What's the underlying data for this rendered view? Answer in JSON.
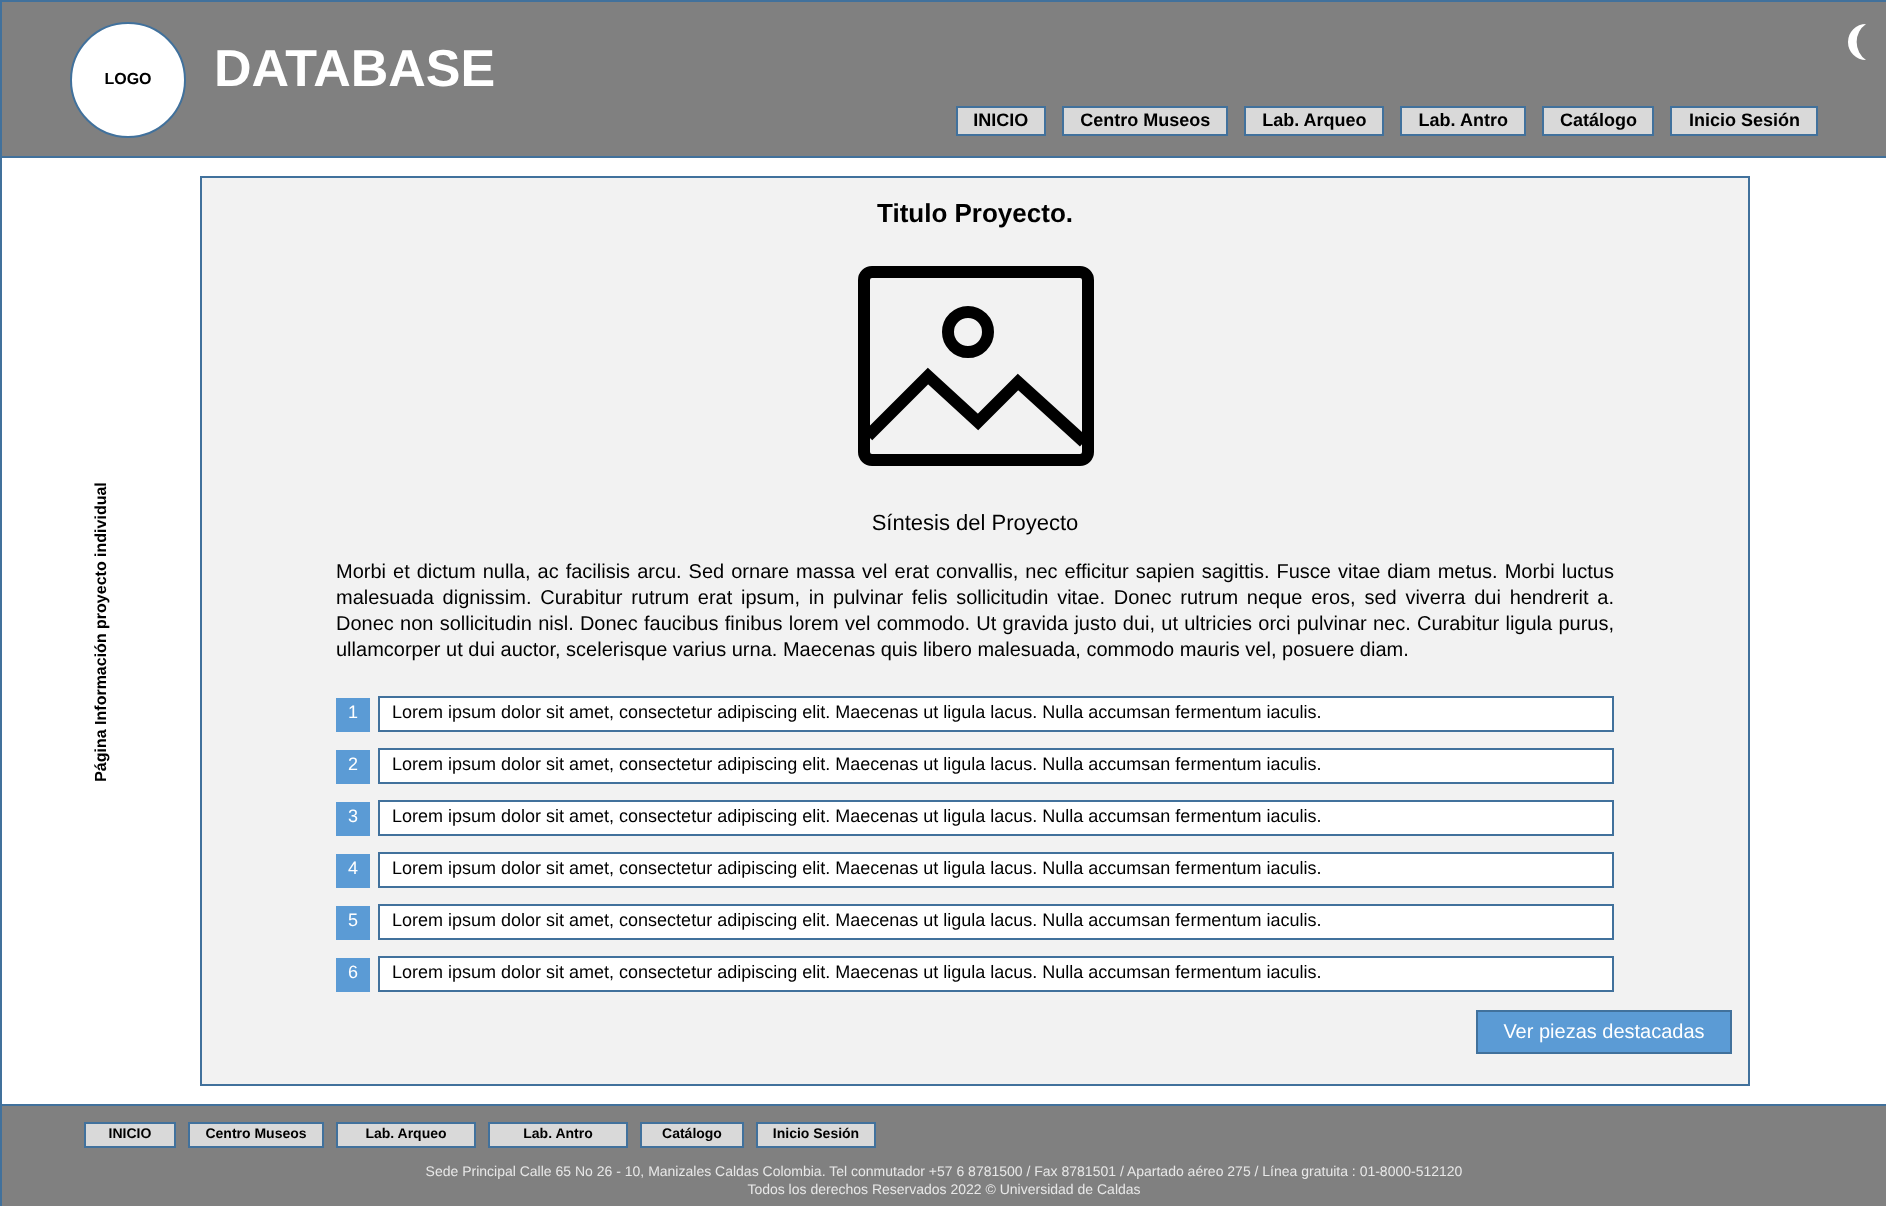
{
  "header": {
    "logo": "LOGO",
    "title": "DATABASE",
    "nav": [
      "INICIO",
      "Centro Museos",
      "Lab. Arqueo",
      "Lab. Antro",
      "Catálogo",
      "Inicio Sesión"
    ]
  },
  "sidebar": {
    "label": "Página Información proyecto individual"
  },
  "project": {
    "title": "Titulo Proyecto.",
    "subtitle": "Síntesis del Proyecto",
    "summary": "Morbi et dictum nulla, ac facilisis arcu. Sed ornare massa vel erat convallis, nec efficitur sapien sagittis. Fusce vitae diam metus. Morbi luctus malesuada dignissim. Curabitur rutrum erat ipsum, in pulvinar felis sollicitudin vitae. Donec rutrum neque eros, sed viverra dui hendrerit a. Donec non sollicitudin nisl. Donec faucibus finibus lorem vel commodo. Ut gravida justo dui, ut ultricies orci pulvinar nec. Curabitur ligula purus, ullamcorper ut dui auctor, scelerisque varius urna. Maecenas quis libero malesuada, commodo mauris vel, posuere diam.",
    "items": [
      {
        "number": "1",
        "text": "Lorem ipsum dolor sit amet, consectetur adipiscing elit. Maecenas ut ligula lacus. Nulla accumsan fermentum iaculis."
      },
      {
        "number": "2",
        "text": "Lorem ipsum dolor sit amet, consectetur adipiscing elit. Maecenas ut ligula lacus. Nulla accumsan fermentum iaculis."
      },
      {
        "number": "3",
        "text": "Lorem ipsum dolor sit amet, consectetur adipiscing elit. Maecenas ut ligula lacus. Nulla accumsan fermentum iaculis."
      },
      {
        "number": "4",
        "text": "Lorem ipsum dolor sit amet, consectetur adipiscing elit. Maecenas ut ligula lacus. Nulla accumsan fermentum iaculis."
      },
      {
        "number": "5",
        "text": "Lorem ipsum dolor sit amet, consectetur adipiscing elit. Maecenas ut ligula lacus. Nulla accumsan fermentum iaculis."
      },
      {
        "number": "6",
        "text": "Lorem ipsum dolor sit amet, consectetur adipiscing elit. Maecenas ut ligula lacus. Nulla accumsan fermentum iaculis."
      }
    ],
    "button": "Ver piezas destacadas"
  },
  "footer": {
    "nav": [
      "INICIO",
      "Centro Museos",
      "Lab. Arqueo",
      "Lab. Antro",
      "Catálogo",
      "Inicio Sesión"
    ],
    "address": "Sede Principal Calle 65 No 26 - 10, Manizales Caldas Colombia. Tel conmutador +57 6 8781500 / Fax 8781501 / Apartado aéreo 275 / Línea gratuita : 01-8000-512120",
    "copyright": "Todos los derechos Reservados 2022 © Universidad de Caldas"
  }
}
